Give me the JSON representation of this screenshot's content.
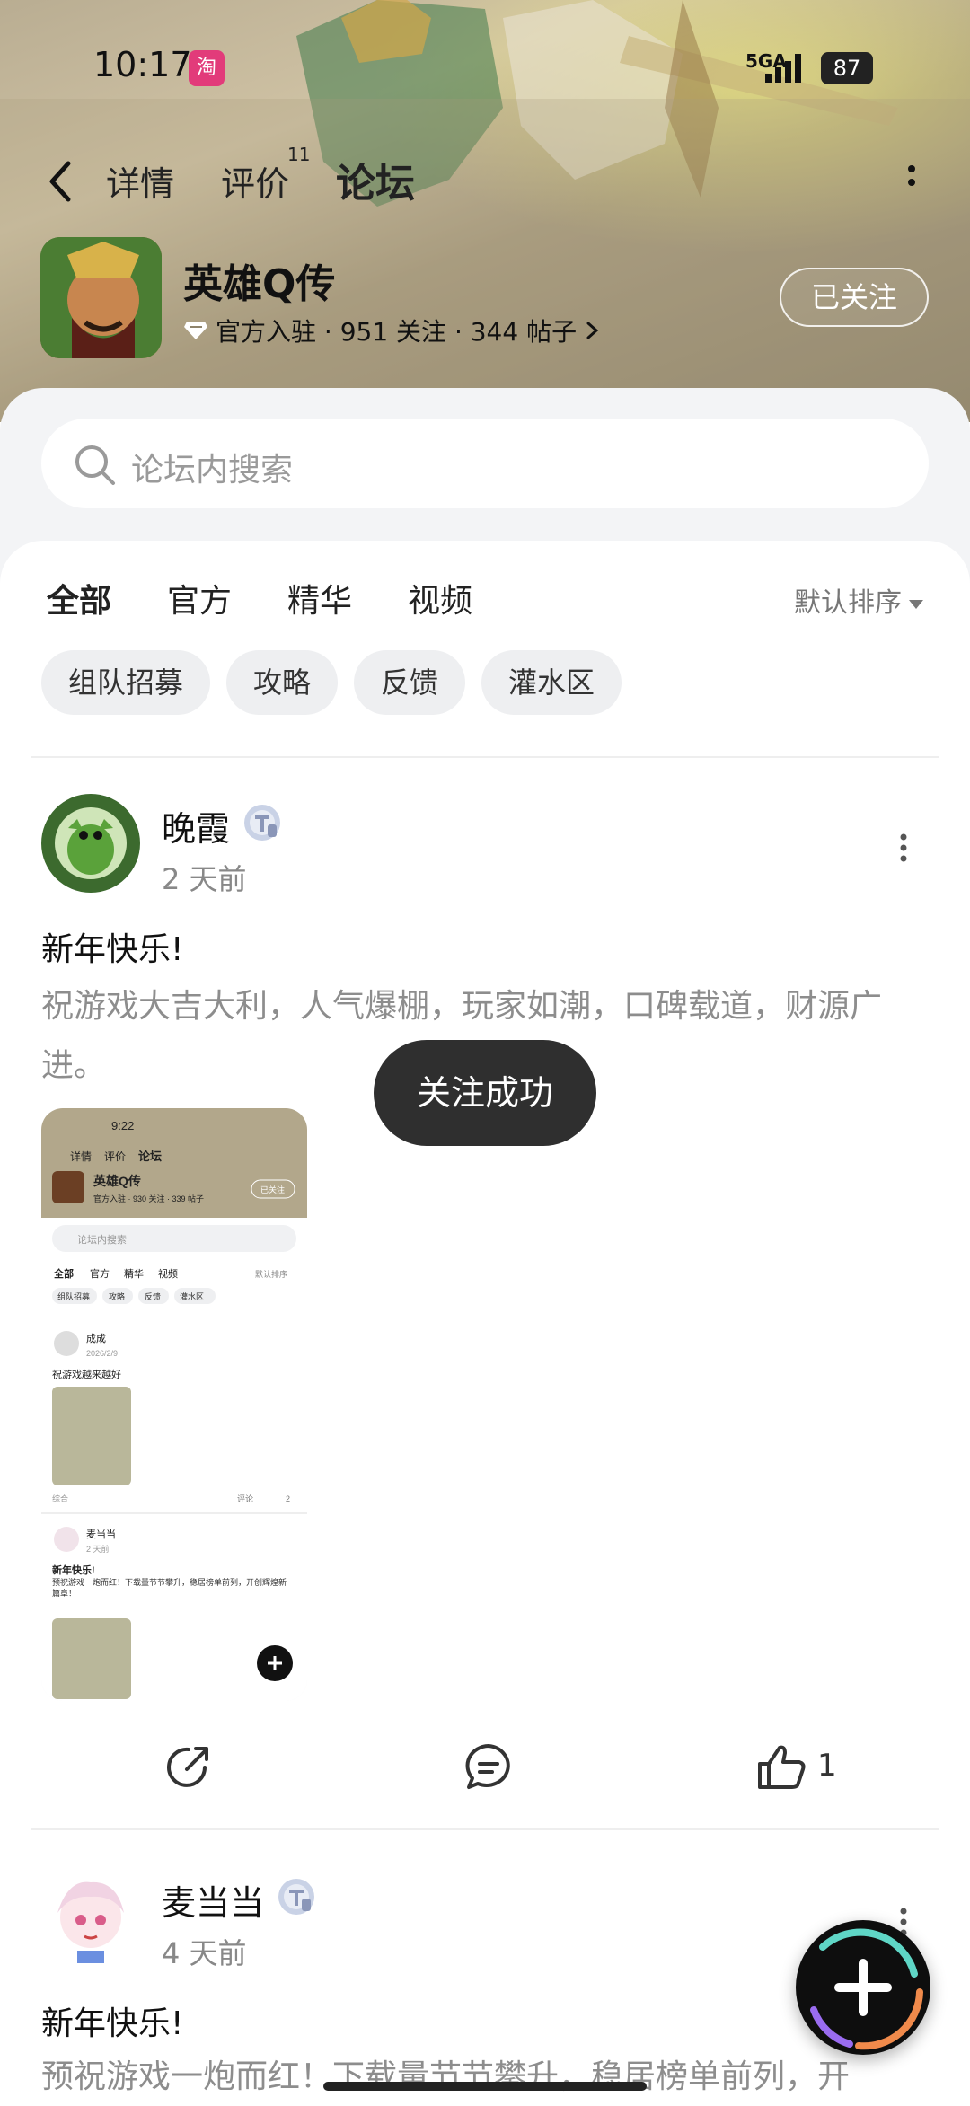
{
  "status_bar": {
    "time": "10:17",
    "app_notification": "淘",
    "network": "5GA",
    "battery": "87"
  },
  "nav": {
    "tabs": [
      {
        "label": "详情"
      },
      {
        "label": "评价",
        "count": "11"
      },
      {
        "label": "论坛"
      }
    ]
  },
  "game": {
    "name": "英雄Q传",
    "meta": "官方入驻 · 951 关注 · 344 帖子",
    "follow_label": "已关注"
  },
  "search": {
    "placeholder": "论坛内搜索"
  },
  "filters": {
    "tabs": [
      "全部",
      "官方",
      "精华",
      "视频"
    ],
    "sort_label": "默认排序",
    "chips": [
      "组队招募",
      "攻略",
      "反馈",
      "灌水区"
    ]
  },
  "posts": [
    {
      "author": "晚霞",
      "time": "2 天前",
      "title": "新年快乐!",
      "body": "祝游戏大吉大利，人气爆棚，玩家如潮，口碑载道，财源广进。",
      "likes": "1"
    },
    {
      "author": "麦当当",
      "time": "4 天前",
      "title": "新年快乐!",
      "body": "预祝游戏一炮而红！下载量节节攀升，稳居榜单前列，开"
    }
  ],
  "thumbnail": {
    "time": "9:22",
    "tabs": [
      "详情",
      "评价",
      "论坛"
    ],
    "game_name": "英雄Q传",
    "meta": "官方入驻 · 930 关注 · 339 帖子",
    "follow_label": "已关注",
    "search_placeholder": "论坛内搜索",
    "filter_tabs": [
      "全部",
      "官方",
      "精华",
      "视频"
    ],
    "sort_label": "默认排序",
    "chips": [
      "组队招募",
      "攻略",
      "反馈",
      "灌水区"
    ],
    "post1_author": "成成",
    "post1_date": "2026/2/9",
    "post1_title": "祝游戏越来越好",
    "post1_tag": "综合",
    "post1_comment": "评论",
    "post1_likes": "2",
    "post2_author": "麦当当",
    "post2_time": "2 天前",
    "post2_title": "新年快乐!",
    "post2_body": "预祝游戏一炮而红！下载量节节攀升，稳居榜单前列，开创辉煌新篇章！"
  },
  "toast": "关注成功",
  "colors": {
    "accent": "#4ec9be",
    "toast_bg": "#2f2f2f",
    "muted_text": "#8d8d8d"
  }
}
